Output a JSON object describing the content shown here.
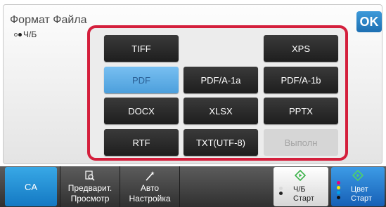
{
  "header": {
    "title": "Формат Файла",
    "mode": "Ч/Б",
    "ok_label": "OK"
  },
  "formats": [
    {
      "id": "tiff",
      "label": "TIFF",
      "state": "normal"
    },
    {
      "id": "xps",
      "label": "XPS",
      "state": "normal"
    },
    {
      "id": "pdf",
      "label": "PDF",
      "state": "selected"
    },
    {
      "id": "pdfa1a",
      "label": "PDF/A-1a",
      "state": "normal"
    },
    {
      "id": "pdfa1b",
      "label": "PDF/A-1b",
      "state": "normal"
    },
    {
      "id": "docx",
      "label": "DOCX",
      "state": "normal"
    },
    {
      "id": "xlsx",
      "label": "XLSX",
      "state": "normal"
    },
    {
      "id": "pptx",
      "label": "PPTX",
      "state": "normal"
    },
    {
      "id": "rtf",
      "label": "RTF",
      "state": "normal"
    },
    {
      "id": "txt",
      "label": "TXT(UTF-8)",
      "state": "normal"
    },
    {
      "id": "execute",
      "label": "Выполн",
      "state": "disabled"
    }
  ],
  "bottom": {
    "ca_label": "CA",
    "preview_line1": "Предварит.",
    "preview_line2": "Просмотр",
    "auto_line1": "Авто",
    "auto_line2": "Настройка",
    "start_bw_line1": "Ч/Б",
    "start_bw_line2": "Старт",
    "start_color_line1": "Цвет",
    "start_color_line2": "Старт"
  },
  "colors": {
    "accent_blue": "#1d6fb2",
    "highlight_red": "#d41f3c",
    "start_green": "#3bb24a"
  },
  "icons": {
    "preview": "magnifier-document-icon",
    "auto": "magic-wand-icon",
    "start": "diamond-start-icon"
  }
}
